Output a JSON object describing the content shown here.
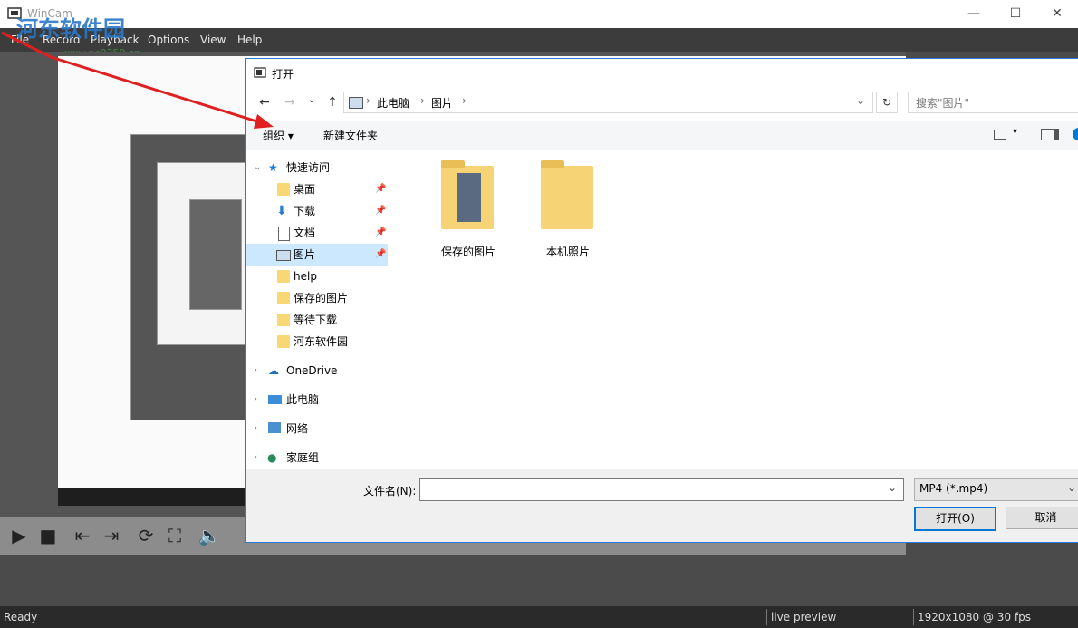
{
  "app": {
    "title": "WinCam",
    "menu": [
      "File",
      "Record",
      "Playback",
      "Options",
      "View",
      "Help"
    ],
    "window_controls": {
      "minimize": "—",
      "maximize": "☐",
      "close": "✕"
    },
    "watermark": "河东软件园",
    "watermark_sub": "www.pc0359.cn",
    "controls": [
      "play-icon",
      "stop-icon",
      "skip-start-icon",
      "skip-end-icon",
      "loop-icon",
      "fullscreen-icon",
      "volume-icon"
    ],
    "status": {
      "left": "Ready",
      "mid": "live preview",
      "right": "1920x1080 @ 30 fps"
    }
  },
  "dialog": {
    "title": "打开",
    "breadcrumb": [
      "此电脑",
      "图片"
    ],
    "search_placeholder": "搜索\"图片\"",
    "toolbar": {
      "organize": "组织",
      "new_folder": "新建文件夹"
    },
    "nav": {
      "quick_access": "快速访问",
      "pinned": [
        "桌面",
        "下载",
        "文档",
        "图片"
      ],
      "folders": [
        "help",
        "保存的图片",
        "等待下载",
        "河东软件园"
      ],
      "onedrive": "OneDrive",
      "this_pc": "此电脑",
      "network": "网络",
      "homegroup": "家庭组"
    },
    "files": [
      "保存的图片",
      "本机照片"
    ],
    "filename_label": "文件名(N):",
    "filename_value": "",
    "filetype": "MP4 (*.mp4)",
    "open_button": "打开(O)",
    "cancel_button": "取消"
  },
  "colors": {
    "accent": "#0078d7",
    "arrow": "#e02020",
    "folder": "#f6d374"
  }
}
